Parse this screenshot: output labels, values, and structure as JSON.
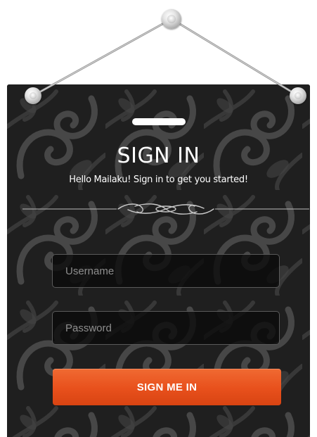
{
  "window": {
    "title": "SIGN IN",
    "subtitle": "Hello Mailaku! Sign in to get you started!"
  },
  "form": {
    "username": {
      "value": "",
      "placeholder": "Username"
    },
    "password": {
      "value": "",
      "placeholder": "Password"
    },
    "submit_label": "SIGN ME IN"
  },
  "icons": {
    "divider": "flourish-ornament-icon",
    "hanger": "hanging-wire-icon",
    "nail": "nail-pin-icon"
  },
  "colors": {
    "board": "#1f1f1f",
    "pattern": "#5a5a5a",
    "accent": "#e8501c",
    "text": "#ffffff",
    "field_border": "#5a5a5a"
  }
}
